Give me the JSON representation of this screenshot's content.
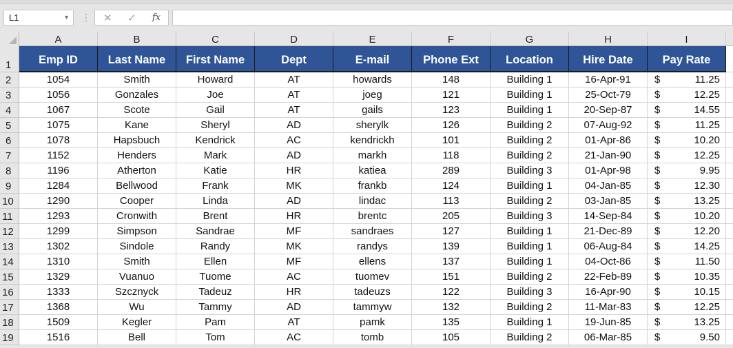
{
  "formula_bar": {
    "name_box": "L1",
    "name_box_dropdown_icon": "chevron-down-icon",
    "cancel_icon": "✕",
    "enter_icon": "✓",
    "fx_label": "fx",
    "formula_value": ""
  },
  "columns": [
    "A",
    "B",
    "C",
    "D",
    "E",
    "F",
    "G",
    "H",
    "I"
  ],
  "row_numbers": [
    "1",
    "2",
    "3",
    "4",
    "5",
    "6",
    "7",
    "8",
    "9",
    "10",
    "11",
    "12",
    "13",
    "14",
    "15",
    "16",
    "17",
    "18",
    "19"
  ],
  "table": {
    "headers": [
      "Emp ID",
      "Last Name",
      "First Name",
      "Dept",
      "E-mail",
      "Phone Ext",
      "Location",
      "Hire Date",
      "Pay Rate"
    ],
    "currency_symbol": "$",
    "rows": [
      [
        "1054",
        "Smith",
        "Howard",
        "AT",
        "howards",
        "148",
        "Building 1",
        "16-Apr-91",
        "11.25"
      ],
      [
        "1056",
        "Gonzales",
        "Joe",
        "AT",
        "joeg",
        "121",
        "Building 1",
        "25-Oct-79",
        "12.25"
      ],
      [
        "1067",
        "Scote",
        "Gail",
        "AT",
        "gails",
        "123",
        "Building 1",
        "20-Sep-87",
        "14.55"
      ],
      [
        "1075",
        "Kane",
        "Sheryl",
        "AD",
        "sherylk",
        "126",
        "Building 2",
        "07-Aug-92",
        "11.25"
      ],
      [
        "1078",
        "Hapsbuch",
        "Kendrick",
        "AC",
        "kendrickh",
        "101",
        "Building 2",
        "01-Apr-86",
        "10.20"
      ],
      [
        "1152",
        "Henders",
        "Mark",
        "AD",
        "markh",
        "118",
        "Building 2",
        "21-Jan-90",
        "12.25"
      ],
      [
        "1196",
        "Atherton",
        "Katie",
        "HR",
        "katiea",
        "289",
        "Building 3",
        "01-Apr-98",
        "9.95"
      ],
      [
        "1284",
        "Bellwood",
        "Frank",
        "MK",
        "frankb",
        "124",
        "Building 1",
        "04-Jan-85",
        "12.30"
      ],
      [
        "1290",
        "Cooper",
        "Linda",
        "AD",
        "lindac",
        "113",
        "Building 2",
        "03-Jan-85",
        "13.25"
      ],
      [
        "1293",
        "Cronwith",
        "Brent",
        "HR",
        "brentc",
        "205",
        "Building 3",
        "14-Sep-84",
        "10.20"
      ],
      [
        "1299",
        "Simpson",
        "Sandrae",
        "MF",
        "sandraes",
        "127",
        "Building 1",
        "21-Dec-89",
        "12.20"
      ],
      [
        "1302",
        "Sindole",
        "Randy",
        "MK",
        "randys",
        "139",
        "Building 1",
        "06-Aug-84",
        "14.25"
      ],
      [
        "1310",
        "Smith",
        "Ellen",
        "MF",
        "ellens",
        "137",
        "Building 1",
        "04-Oct-86",
        "11.50"
      ],
      [
        "1329",
        "Vuanuo",
        "Tuome",
        "AC",
        "tuomev",
        "151",
        "Building 2",
        "22-Feb-89",
        "10.35"
      ],
      [
        "1333",
        "Szcznyck",
        "Tadeuz",
        "HR",
        "tadeuzs",
        "122",
        "Building 3",
        "16-Apr-90",
        "10.15"
      ],
      [
        "1368",
        "Wu",
        "Tammy",
        "AD",
        "tammyw",
        "132",
        "Building 2",
        "11-Mar-83",
        "12.25"
      ],
      [
        "1509",
        "Kegler",
        "Pam",
        "AT",
        "pamk",
        "135",
        "Building 1",
        "19-Jun-85",
        "13.25"
      ],
      [
        "1516",
        "Bell",
        "Tom",
        "AC",
        "tomb",
        "105",
        "Building 2",
        "06-Mar-85",
        "9.50"
      ]
    ]
  },
  "colors": {
    "header_fill": "#2f5597",
    "header_text": "#ffffff",
    "grid_line": "#d4d4d4",
    "chrome_bg": "#e6e6e6"
  }
}
